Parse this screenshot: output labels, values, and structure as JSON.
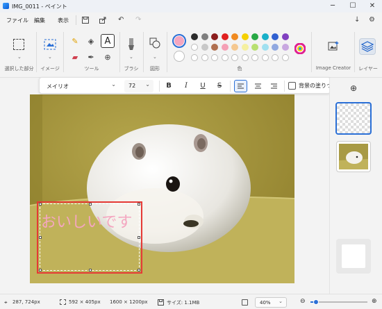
{
  "titlebar": {
    "title": "IMG_0011 - ペイント",
    "minimize": "─",
    "maximize": "☐",
    "close": "✕"
  },
  "menu": {
    "file": "ファイル",
    "edit": "編集",
    "view": "表示",
    "save_icon": "save-icon",
    "share_icon": "share-icon",
    "undo": "↶",
    "redo": "↷",
    "download": "↓",
    "settings": "⚙"
  },
  "ribbon": {
    "groups": {
      "selection": "選択した部分",
      "image": "イメージ",
      "tools": "ツール",
      "brushes": "ブラシ",
      "shapes": "図形",
      "colors": "色",
      "image_creator": "Image Creator",
      "layers": "レイヤー"
    },
    "colors_row1": [
      "#2b2b2b",
      "#7f7f7f",
      "#8b1d1d",
      "#e02020",
      "#f08a20",
      "#f5d000",
      "#27a844",
      "#18b0c8",
      "#3060d0",
      "#8040c0"
    ],
    "colors_row2": [
      "#ffffff",
      "#c8c8c8",
      "#b07050",
      "#f5a0b5",
      "#f5c890",
      "#f5f0a0",
      "#b8e070",
      "#a0e0f0",
      "#90a8e0",
      "#c8a8e0"
    ],
    "primary_color": "#f4a6c0",
    "secondary_color": "#ffffff"
  },
  "format": {
    "font": "メイリオ",
    "size": "72",
    "bold": "B",
    "italic": "I",
    "underline": "U",
    "strike": "S",
    "fill_label": "背景の塗りつぶし"
  },
  "canvas": {
    "text": "おいしいです",
    "text_color": "#f4a6c0",
    "highlight": "#e53935"
  },
  "statusbar": {
    "cursor": "287, 724px",
    "selection": "592 × 405px",
    "image_size": "1600 × 1200px",
    "file_size": "サイズ: 1.1MB",
    "zoom": "40%",
    "zoom_level": 0.4
  }
}
